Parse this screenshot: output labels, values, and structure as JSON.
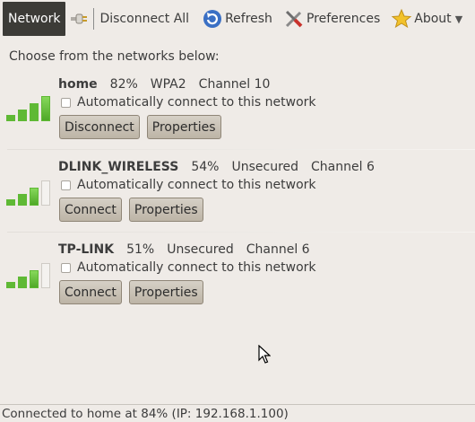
{
  "toolbar": {
    "network": "Network",
    "disconnect_all": "Disconnect All",
    "refresh": "Refresh",
    "preferences": "Preferences",
    "about": "About",
    "menu_arrow": "▼"
  },
  "intro": "Choose from the networks below:",
  "networks": [
    {
      "name": "home",
      "strength": "82%",
      "security": "WPA2",
      "channel": "Channel 10",
      "auto_label": "Automatically connect to this network",
      "auto_checked": false,
      "action": "Disconnect",
      "properties": "Properties",
      "signal_bars_filled": 4
    },
    {
      "name": "DLINK_WIRELESS",
      "strength": "54%",
      "security": "Unsecured",
      "channel": "Channel 6",
      "auto_label": "Automatically connect to this network",
      "auto_checked": false,
      "action": "Connect",
      "properties": "Properties",
      "signal_bars_filled": 3
    },
    {
      "name": "TP-LINK",
      "strength": "51%",
      "security": "Unsecured",
      "channel": "Channel 6",
      "auto_label": "Automatically connect to this network",
      "auto_checked": false,
      "action": "Connect",
      "properties": "Properties",
      "signal_bars_filled": 3
    }
  ],
  "status": "Connected to home at 84% (IP: 192.168.1.100)",
  "colors": {
    "signal_on": "#5fb935",
    "active_tab_bg": "#3c3b37",
    "window_bg": "#efebe7"
  }
}
